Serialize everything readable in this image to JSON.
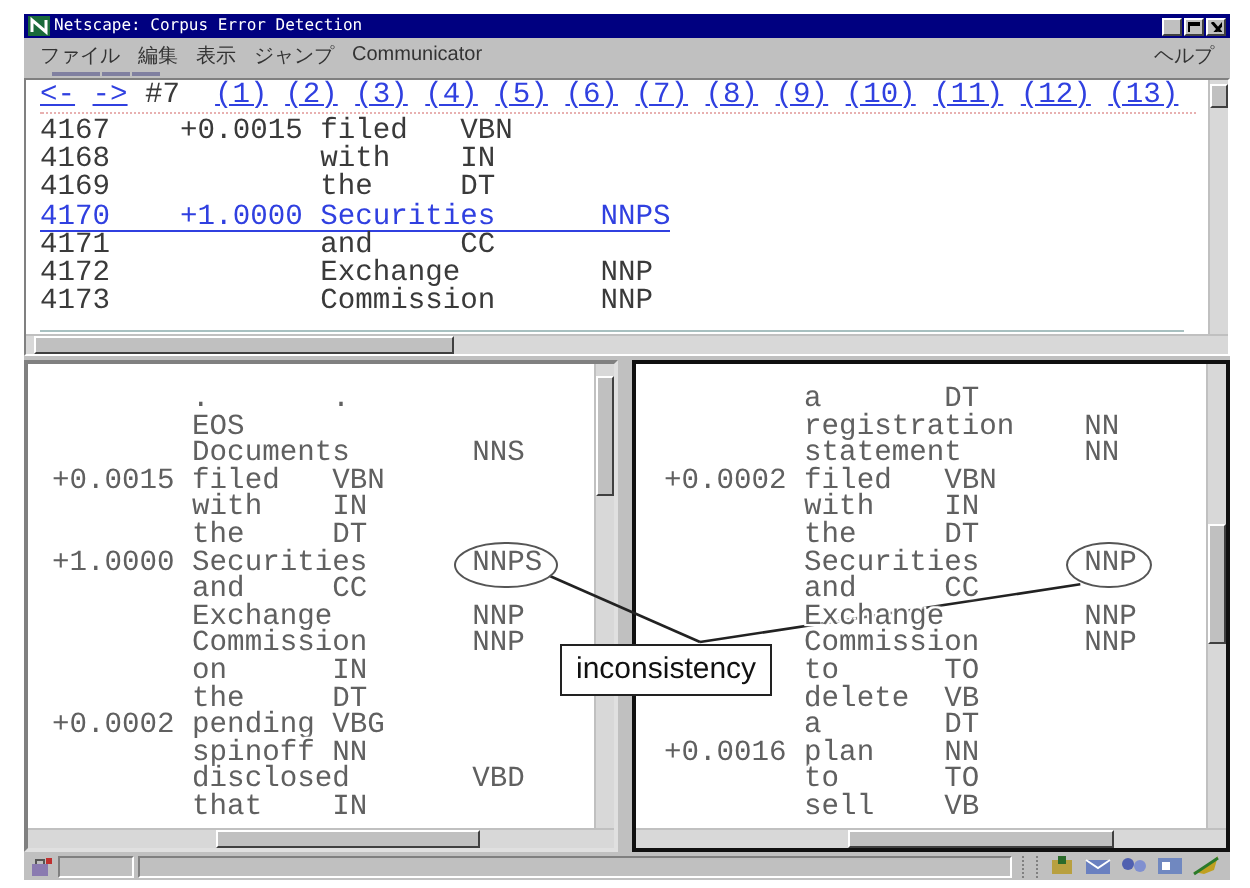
{
  "window": {
    "title": "Netscape: Corpus Error Detection"
  },
  "menu": {
    "items": [
      "ファイル",
      "編集",
      "表示",
      "ジャンプ",
      "Communicator"
    ],
    "help": "ヘルプ"
  },
  "top_frame": {
    "nav": [
      {
        "label": "<-",
        "kind": "link"
      },
      {
        "label": "->",
        "kind": "link"
      },
      {
        "label": "#7",
        "kind": "current"
      },
      {
        "label": "(1)",
        "kind": "link"
      },
      {
        "label": "(2)",
        "kind": "link"
      },
      {
        "label": "(3)",
        "kind": "link"
      },
      {
        "label": "(4)",
        "kind": "link"
      },
      {
        "label": "(5)",
        "kind": "link"
      },
      {
        "label": "(6)",
        "kind": "link"
      },
      {
        "label": "(7)",
        "kind": "link"
      },
      {
        "label": "(8)",
        "kind": "link"
      },
      {
        "label": "(9)",
        "kind": "link"
      },
      {
        "label": "(10)",
        "kind": "link"
      },
      {
        "label": "(11)",
        "kind": "link"
      },
      {
        "label": "(12)",
        "kind": "link"
      },
      {
        "label": "(13)",
        "kind": "link"
      }
    ],
    "rows": [
      {
        "number": "4167",
        "score": "+0.0015",
        "word": "filed",
        "pos": "VBN",
        "selected": false
      },
      {
        "number": "4168",
        "word": "with",
        "pos": "IN",
        "selected": false
      },
      {
        "number": "4169",
        "word": "the",
        "pos": "DT",
        "selected": false
      },
      {
        "number": "4170",
        "score": "+1.0000",
        "word": "Securities",
        "pos_far": "NNPS",
        "selected": true
      },
      {
        "number": "4171",
        "word": "and",
        "pos": "CC",
        "selected": false
      },
      {
        "number": "4172",
        "word": "Exchange",
        "pos_far": "NNP",
        "selected": false
      },
      {
        "number": "4173",
        "word": "Commission",
        "pos_far": "NNP",
        "selected": false
      }
    ]
  },
  "bottom_frames": [
    {
      "active": false,
      "rows": [
        {
          "word": ".",
          "pos": ".",
          "circled": false
        },
        {
          "word": "EOS",
          "circled": false
        },
        {
          "word": "Documents",
          "pos_far": "NNS",
          "circled": false
        },
        {
          "score": "+0.0015",
          "word": "filed",
          "pos": "VBN",
          "circled": false
        },
        {
          "word": "with",
          "pos": "IN",
          "circled": false
        },
        {
          "word": "the",
          "pos": "DT",
          "circled": false
        },
        {
          "score": "+1.0000",
          "word": "Securities",
          "pos_far": "NNPS",
          "circled": true
        },
        {
          "word": "and",
          "pos": "CC",
          "circled": false
        },
        {
          "word": "Exchange",
          "pos_far": "NNP",
          "circled": false
        },
        {
          "word": "Commission",
          "pos_far": "NNP",
          "circled": false
        },
        {
          "word": "on",
          "pos": "IN",
          "circled": false
        },
        {
          "word": "the",
          "pos": "DT",
          "circled": false
        },
        {
          "score": "+0.0002",
          "word": "pending",
          "pos": "VBG",
          "circled": false
        },
        {
          "word": "spinoff",
          "pos": "NN",
          "circled": false
        },
        {
          "word": "disclosed",
          "pos_far": "VBD",
          "circled": false
        },
        {
          "word": "that",
          "pos": "IN",
          "circled": false
        }
      ]
    },
    {
      "active": true,
      "rows": [
        {
          "word": "a",
          "pos": "DT",
          "circled": false
        },
        {
          "word": "registration",
          "pos_far": "NN",
          "circled": false
        },
        {
          "word": "statement",
          "pos_far": "NN",
          "circled": false
        },
        {
          "score": "+0.0002",
          "word": "filed",
          "pos": "VBN",
          "circled": false
        },
        {
          "word": "with",
          "pos": "IN",
          "circled": false
        },
        {
          "word": "the",
          "pos": "DT",
          "circled": false
        },
        {
          "word": "Securities",
          "pos_far": "NNP",
          "circled": true
        },
        {
          "word": "and",
          "pos": "CC",
          "circled": false
        },
        {
          "word": "Exchange",
          "pos_far": "NNP",
          "circled": false
        },
        {
          "word": "Commission",
          "pos_far": "NNP",
          "circled": false
        },
        {
          "word": "to",
          "pos": "TO",
          "circled": false
        },
        {
          "word": "delete",
          "pos": "VB",
          "circled": false
        },
        {
          "word": "a",
          "pos": "DT",
          "circled": false
        },
        {
          "score": "+0.0016",
          "word": "plan",
          "pos": "NN",
          "circled": false
        },
        {
          "word": "to",
          "pos": "TO",
          "circled": false
        },
        {
          "word": "sell",
          "pos": "VB",
          "circled": false
        }
      ]
    }
  ],
  "annotation": {
    "label": "inconsistency"
  }
}
